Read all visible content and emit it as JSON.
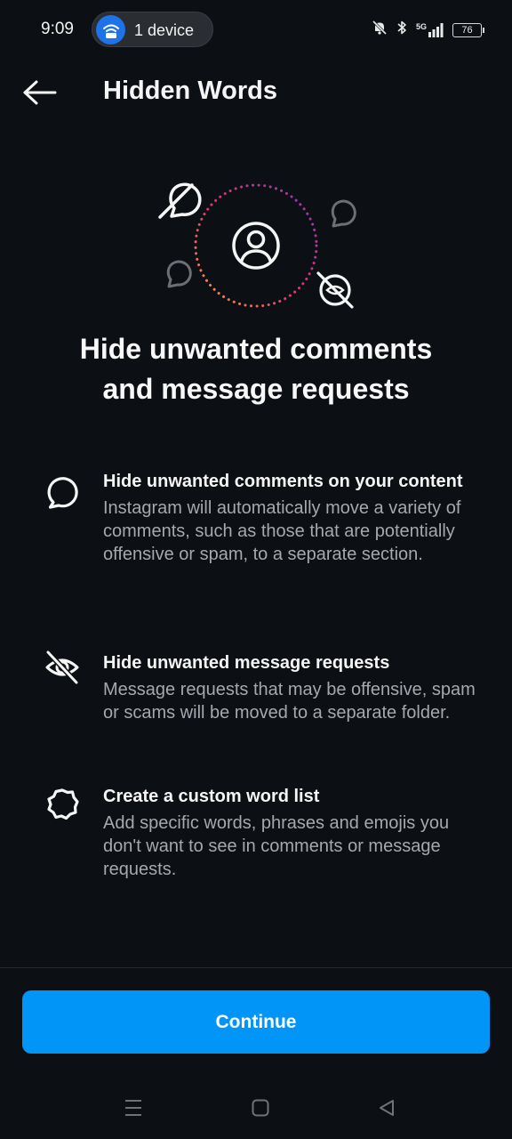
{
  "status_bar": {
    "time": "9:09",
    "device_pill_label": "1 device",
    "battery_level": "76",
    "network": "5G"
  },
  "header": {
    "title": "Hidden Words"
  },
  "hero": {
    "headline_line1": "Hide unwanted comments",
    "headline_line2": "and message requests"
  },
  "features": [
    {
      "icon": "comment-bubble-icon",
      "title": "Hide unwanted comments on your content",
      "description": "Instagram will automatically move a variety of comments, such as those that are potentially offensive or spam, to a separate section."
    },
    {
      "icon": "eye-off-icon",
      "title": "Hide unwanted message requests",
      "description": "Message requests that may be offensive, spam or scams will be moved to a separate folder."
    },
    {
      "icon": "gear-icon",
      "title": "Create a custom word list",
      "description": "Add specific words, phrases and emojis you don't want to see in comments or message requests."
    }
  ],
  "footer": {
    "continue_label": "Continue"
  },
  "colors": {
    "background": "#0c1014",
    "accent": "#0095f6",
    "secondary_text": "#a5a8ad"
  }
}
